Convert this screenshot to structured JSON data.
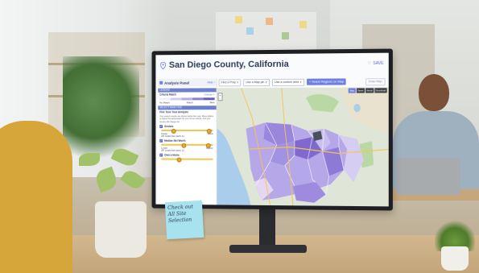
{
  "app": {
    "title": "San Diego County, California",
    "save_label": "SAVE"
  },
  "toolbar": {
    "dropdown_1": "Find a Prop ∨",
    "dropdown_2": "Use a Map pin ∨",
    "dropdown_3": "Use a custom area ∨",
    "primary_label": "+ Select Regions on Map",
    "ghost_label": "Draw Map"
  },
  "panel": {
    "title": "Analysis Panel",
    "hide_label": "Hide ‹",
    "legend_header": "LEGEND",
    "legend_criteria_label": "Criteria Match",
    "legend_change_label": "Change ∨",
    "legend_ramp_labels": [
      "No Match",
      "Match",
      "Best"
    ],
    "ramp_colors": [
      "#efeefa",
      "#d3cdf2",
      "#b5a8ea",
      "#8f7bd9",
      "#6a57c4"
    ],
    "section_header": "SELECT ANALYSIS",
    "intro_title": "Fine Tune Your Analysis",
    "intro_text": "Your search results are shown below the map. Move sliders to adjust the parameters for your home criteria, and your results will change too.",
    "criteria": [
      {
        "label": "Seniors",
        "low": "Fewer",
        "high": "More",
        "note": "ZIP Codes that match: 12"
      },
      {
        "label": "Median Net Worth",
        "low": "Lower",
        "high": "Higher",
        "note": "ZIP Codes that match: 11"
      },
      {
        "label": "Own a Home",
        "low": "",
        "high": "",
        "note": ""
      }
    ]
  },
  "map": {
    "tags": [
      "Map",
      "Street",
      "Aerial",
      "Download"
    ]
  },
  "sticky_note": {
    "text": "Check out\nAll Site\nSelection"
  }
}
